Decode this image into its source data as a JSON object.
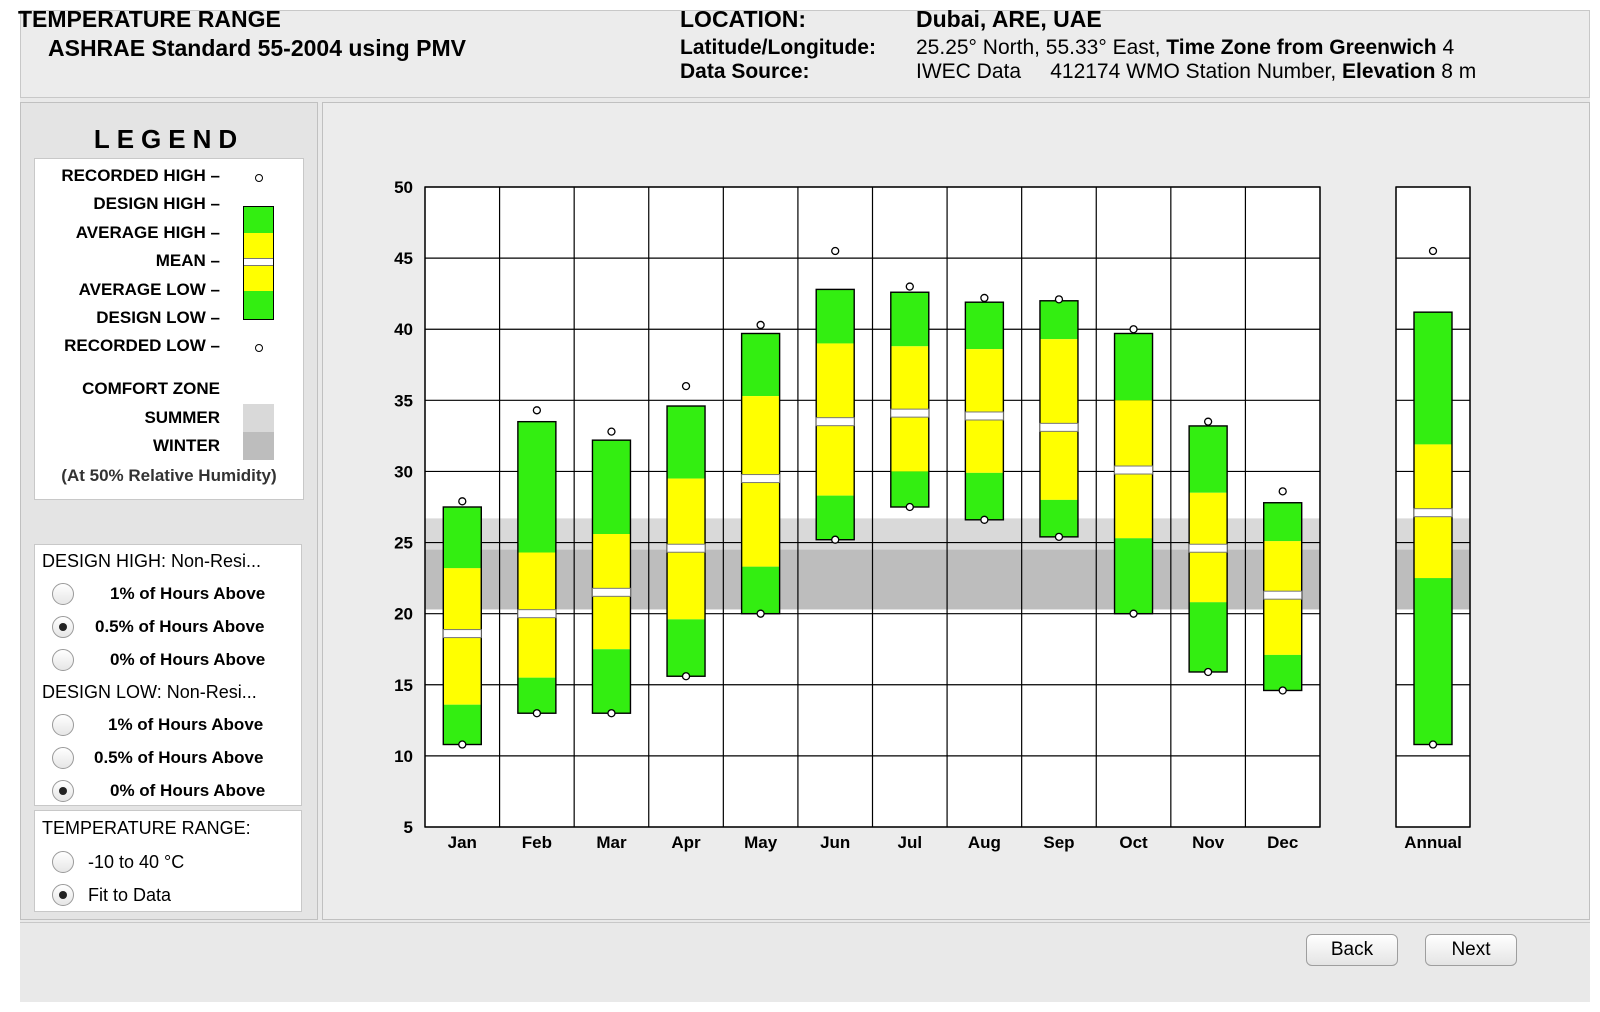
{
  "header": {
    "title": "TEMPERATURE RANGE",
    "subtitle": "ASHRAE Standard 55-2004 using PMV",
    "location_label": "LOCATION:",
    "location_value": "Dubai, ARE, UAE",
    "latlon_label": "Latitude/Longitude:",
    "latlon_value": "25.25° North, 55.33° East,",
    "timezone_label": "Time Zone from Greenwich",
    "timezone_value": "4",
    "source_label": "Data Source:",
    "source_value": "IWEC Data",
    "station_value": "412174 WMO Station Number,",
    "elevation_label": "Elevation",
    "elevation_value": "8 m"
  },
  "legend": {
    "title": "LEGEND",
    "recorded_high": "RECORDED HIGH –",
    "design_high": "DESIGN HIGH –",
    "average_high": "AVERAGE HIGH –",
    "mean": "MEAN –",
    "average_low": "AVERAGE LOW –",
    "design_low": "DESIGN LOW –",
    "recorded_low": "RECORDED LOW –",
    "comfort_zone": "COMFORT ZONE",
    "summer": "SUMMER",
    "winter": "WINTER",
    "note": "(At 50% Relative Humidity)"
  },
  "design_high": {
    "label": "DESIGN HIGH:  Non-Resi...",
    "options": [
      "1% of Hours Above",
      "0.5% of Hours Above",
      "0% of Hours Above"
    ],
    "selected": 1
  },
  "design_low": {
    "label": "DESIGN LOW:  Non-Resi...",
    "options": [
      "1% of Hours Above",
      "0.5% of Hours Above",
      "0% of Hours Above"
    ],
    "selected": 2
  },
  "temperature_range": {
    "label": "TEMPERATURE RANGE:",
    "options": [
      "-10 to 40 °C",
      "Fit to Data"
    ],
    "selected": 1
  },
  "buttons": {
    "back": "Back",
    "next": "Next"
  },
  "colors": {
    "green": "#33ee11",
    "yellow": "#ffff00",
    "comfort_summer": "#d9d9d9",
    "comfort_winter": "#bdbdbd"
  },
  "chart_data": {
    "type": "bar",
    "subtype": "range",
    "ylim": [
      5,
      50
    ],
    "yticks": [
      5,
      10,
      15,
      20,
      25,
      30,
      35,
      40,
      45,
      50
    ],
    "grid": true,
    "categories": [
      "Jan",
      "Feb",
      "Mar",
      "Apr",
      "May",
      "Jun",
      "Jul",
      "Aug",
      "Sep",
      "Oct",
      "Nov",
      "Dec"
    ],
    "series": [
      {
        "name": "RECORDED HIGH",
        "values": [
          27.9,
          34.3,
          32.8,
          36.0,
          40.3,
          45.5,
          43.0,
          42.2,
          42.1,
          40.0,
          33.5,
          28.6
        ]
      },
      {
        "name": "DESIGN HIGH",
        "values": [
          27.5,
          33.5,
          32.2,
          34.6,
          39.7,
          42.8,
          42.6,
          41.9,
          42.0,
          39.7,
          33.2,
          27.8
        ]
      },
      {
        "name": "AVERAGE HIGH",
        "values": [
          23.2,
          24.3,
          25.6,
          29.5,
          35.3,
          39.0,
          38.8,
          38.6,
          39.3,
          35.0,
          28.5,
          25.1
        ]
      },
      {
        "name": "MEAN",
        "values": [
          18.6,
          20.0,
          21.5,
          24.6,
          29.5,
          33.5,
          34.1,
          33.9,
          33.1,
          30.1,
          24.6,
          21.3
        ]
      },
      {
        "name": "AVERAGE LOW",
        "values": [
          13.6,
          15.5,
          17.5,
          19.6,
          23.3,
          28.3,
          30.0,
          29.9,
          28.0,
          25.3,
          20.8,
          17.1
        ]
      },
      {
        "name": "DESIGN LOW",
        "values": [
          10.8,
          13.0,
          13.0,
          15.6,
          20.0,
          25.2,
          27.5,
          26.6,
          25.4,
          20.0,
          15.9,
          14.6
        ]
      },
      {
        "name": "RECORDED LOW",
        "values": [
          10.8,
          13.0,
          13.0,
          15.6,
          20.0,
          25.2,
          27.5,
          26.6,
          25.4,
          20.0,
          15.9,
          14.6
        ]
      }
    ],
    "annual": {
      "label": "Annual",
      "recorded_high": 45.5,
      "design_high": 41.2,
      "average_high": 31.9,
      "mean": 27.1,
      "average_low": 22.5,
      "design_low": 10.8,
      "recorded_low": 10.8
    },
    "comfort_zone": {
      "summer": [
        20.3,
        26.7
      ],
      "winter": [
        20.3,
        24.5
      ]
    }
  }
}
